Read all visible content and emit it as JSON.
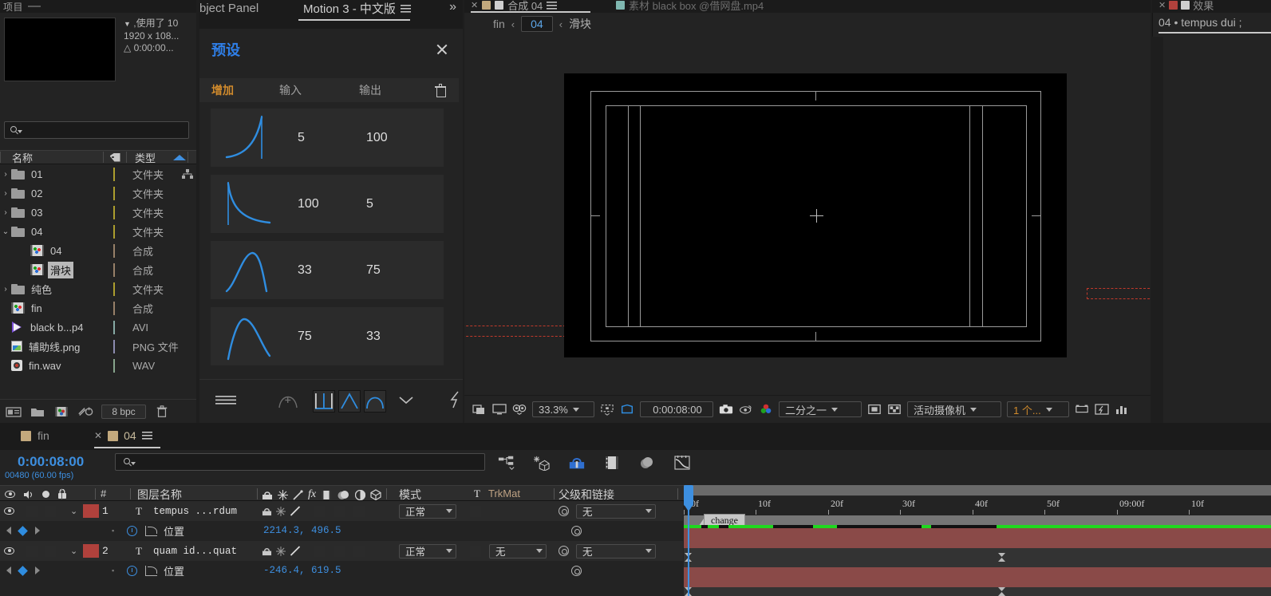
{
  "project": {
    "tab_label": "项目",
    "minimize_icon": "minimize-icon",
    "thumbnail_name": "thumbnail-preview",
    "meta": {
      "line1": ",使用了 10",
      "line2": "1920 x 108...",
      "line3": "0:00:00..."
    },
    "search_placeholder": "",
    "columns": {
      "name": "名称",
      "tag": "tag-icon",
      "type": "类型",
      "sort": "sort-ascending-icon"
    },
    "items": [
      {
        "indent": 0,
        "disclosure": "collapsed",
        "icon": "folder-icon",
        "label": "01",
        "swatch": "#d8c63a",
        "type": "文件夹",
        "extra": "hierarchy-icon"
      },
      {
        "indent": 0,
        "disclosure": "collapsed",
        "icon": "folder-icon",
        "label": "02",
        "swatch": "#d8c63a",
        "type": "文件夹",
        "extra": ""
      },
      {
        "indent": 0,
        "disclosure": "collapsed",
        "icon": "folder-icon",
        "label": "03",
        "swatch": "#d8c63a",
        "type": "文件夹",
        "extra": ""
      },
      {
        "indent": 0,
        "disclosure": "expanded",
        "icon": "folder-icon",
        "label": "04",
        "swatch": "#d8c63a",
        "type": "文件夹",
        "extra": ""
      },
      {
        "indent": 1,
        "disclosure": "none",
        "icon": "comp-icon",
        "label": "04",
        "swatch": "#bda183",
        "type": "合成",
        "extra": ""
      },
      {
        "indent": 1,
        "disclosure": "none",
        "icon": "comp-icon",
        "label": "滑块",
        "swatch": "#bda183",
        "type": "合成",
        "extra": "",
        "selected": true
      },
      {
        "indent": 0,
        "disclosure": "collapsed",
        "icon": "folder-icon",
        "label": "纯色",
        "swatch": "#d8c63a",
        "type": "文件夹",
        "extra": ""
      },
      {
        "indent": 0,
        "disclosure": "none",
        "icon": "comp-icon",
        "label": "fin",
        "swatch": "#bda183",
        "type": "合成",
        "extra": ""
      },
      {
        "indent": 0,
        "disclosure": "none",
        "icon": "avi-icon",
        "label": "black b...p4",
        "swatch": "#a8d5cd",
        "type": "AVI",
        "extra": ""
      },
      {
        "indent": 0,
        "disclosure": "none",
        "icon": "png-icon",
        "label": "辅助线.png",
        "swatch": "#b0b0dd",
        "type": "PNG 文件",
        "extra": ""
      },
      {
        "indent": 0,
        "disclosure": "none",
        "icon": "wav-icon",
        "label": "fin.wav",
        "swatch": "#a8ceb0",
        "type": "WAV",
        "extra": ""
      }
    ],
    "bottom_bar": {
      "icons": [
        "new-folder-bin-icon",
        "new-folder-icon",
        "new-composition-icon",
        "project-settings-icon"
      ],
      "bpc_label": "8 bpc",
      "delete_icon": "trash-icon"
    }
  },
  "motion_panel": {
    "prev_tab_label": "bject Panel",
    "tab_label": "Motion 3 - 中文版",
    "menu_icon": "hamburger-icon",
    "overflow_icon": "chevron-double-right-icon",
    "section_title": "预设",
    "close_icon": "close-icon",
    "columns": {
      "add": "增加",
      "input": "输入",
      "output": "输出",
      "delete_icon": "trash-icon"
    },
    "presets": [
      {
        "curve": "ease-in-spike",
        "input": "5",
        "output": "100"
      },
      {
        "curve": "ease-out-decay",
        "input": "100",
        "output": "5"
      },
      {
        "curve": "peak-left",
        "input": "33",
        "output": "75"
      },
      {
        "curve": "peak-right",
        "input": "75",
        "output": "33"
      }
    ],
    "bottom_icons": [
      "hamburger-menu-icon",
      "add-curve-icon",
      "step-curve-icon",
      "triangle-curve-icon",
      "dome-curve-icon",
      "chevron-down-icon",
      "lightning-icon"
    ]
  },
  "comp_viewer": {
    "tab_active": "合成 04",
    "tab_active_menu_icon": "hamburger-icon",
    "tab_inactive": "素材 black box @借网盘.mp4",
    "breadcrumb": {
      "root": "fin",
      "current": "04",
      "child": "滑块",
      "chevron": "chevron-left-icon"
    },
    "bottom": {
      "icons_left": [
        "toggle-layers-icon",
        "monitor-icon",
        "3d-glasses-icon"
      ],
      "zoom": "33.3%",
      "grid_icon": "grid-guides-icon",
      "region_icon": "region-of-interest-icon",
      "time": "0:00:08:00",
      "snapshot_icon": "camera-icon",
      "show-snapshot_icon": "show-snapshot-icon",
      "channels_icon": "channels-icon",
      "resolution": "二分之一",
      "alpha_icons": [
        "transparency-grid-icon",
        "checkerboard-icon"
      ],
      "camera": "活动摄像机",
      "views": "1 个...",
      "right_icons": [
        "pixel-aspect-icon",
        "fast-preview-icon",
        "timeline-graph-icon"
      ]
    }
  },
  "right_panel": {
    "tab_label": "效果",
    "close_icon": "close-icon",
    "breadcrumb": "04 • tempus dui ;"
  },
  "timeline": {
    "tabs": {
      "inactive": "fin",
      "active": "04",
      "close_icon": "close-icon",
      "menu_icon": "hamburger-icon"
    },
    "current_time": "0:00:08:00",
    "frame_info": "00480 (60.00 fps)",
    "search_placeholder": "",
    "tool_icons": [
      "composition-mini-flowchart-icon",
      "draft-3d-icon",
      "hide-shy-layers-icon",
      "frame-blending-icon",
      "motion-blur-icon",
      "graph-editor-icon"
    ],
    "columns": {
      "video_icon": "eye-icon",
      "audio_icon": "speaker-icon",
      "solo_icon": "solo-icon",
      "lock_icon": "lock-icon",
      "tag_icon": "label-icon",
      "num": "#",
      "layer_name": "图层名称",
      "switches": [
        "shy-icon",
        "collapse-icon",
        "quality-icon",
        "effects-icon",
        "frame-blend-icon",
        "motion-blur-icon",
        "adjustment-icon",
        "3d-layer-icon"
      ],
      "mode": "模式",
      "t": "T",
      "trkmat": "TrkMat",
      "parent_link": "父级和链接"
    },
    "layers": [
      {
        "num": "1",
        "type_letter": "T",
        "name": "tempus ...rdum",
        "color": "#b0413c",
        "mode": "正常",
        "trkmat": "",
        "parent": "无",
        "property": {
          "name": "位置",
          "value": "2214.3, 496.5"
        }
      },
      {
        "num": "2",
        "type_letter": "T",
        "name": "quam id...quat",
        "color": "#b0413c",
        "mode": "正常",
        "trkmat": "无",
        "parent": "无",
        "property": {
          "name": "位置",
          "value": "-246.4, 619.5"
        }
      }
    ],
    "ruler": {
      "labels": [
        "00f",
        "10f",
        "20f",
        "30f",
        "40f",
        "50f",
        "09:00f",
        "10f"
      ],
      "positions": [
        0,
        90,
        181,
        271,
        362,
        452,
        543,
        633
      ]
    },
    "marker": {
      "label": "change"
    },
    "playhead_time": "0:00:08:00"
  },
  "colors": {
    "accent_blue": "#3d8fe0",
    "panel_bg": "#232323",
    "tab_bg": "#1b1b1b",
    "layer_red": "#8a4a48",
    "cache_green": "#1fd81f",
    "orange": "#d08a2c"
  }
}
